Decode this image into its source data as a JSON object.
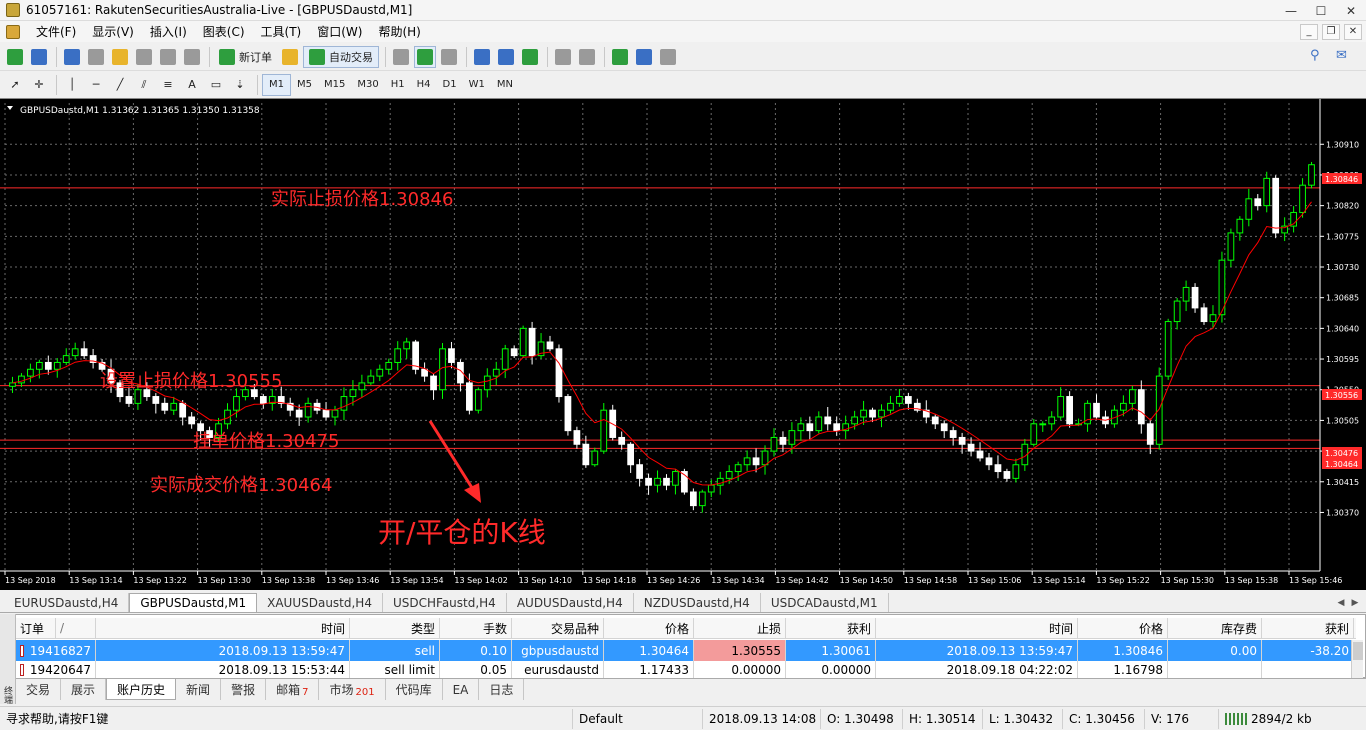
{
  "window": {
    "title": "61057161: RakutenSecuritiesAustralia-Live - [GBPUSDaustd,M1]",
    "min_label": "—",
    "max_label": "☐",
    "close_label": "✕"
  },
  "menu": {
    "items": [
      "文件(F)",
      "显示(V)",
      "插入(I)",
      "图表(C)",
      "工具(T)",
      "窗口(W)",
      "帮助(H)"
    ]
  },
  "toolbar": {
    "new_order": "新订单",
    "auto_trading": "自动交易",
    "timeframes": [
      "M1",
      "M5",
      "M15",
      "M30",
      "H1",
      "H4",
      "D1",
      "W1",
      "MN"
    ]
  },
  "chart": {
    "header": "GBPUSDaustd,M1  1.31362 1.31365 1.31350 1.31358",
    "annotations": {
      "actual_sl": "实际止损价格1.30846",
      "set_sl": "设置止损价格1.30555",
      "pending": "挂单价格1.30475",
      "actual_fill": "实际成交价格1.30464",
      "candle_note": "开/平仓的K线"
    },
    "price_tags": {
      "sl_actual": "1.30846",
      "sl_set": "1.30556",
      "pending": "1.30476",
      "fill": "1.30464"
    }
  },
  "chart_data": {
    "type": "candlestick",
    "symbol": "GBPUSDaustd",
    "timeframe": "M1",
    "ylim": [
      1.3029,
      1.3095
    ],
    "price_ticks": [
      "1.30910",
      "1.30865",
      "1.30820",
      "1.30775",
      "1.30730",
      "1.30685",
      "1.30640",
      "1.30595",
      "1.30550",
      "1.30505",
      "1.30460",
      "1.30415",
      "1.30370"
    ],
    "price_tick_values": [
      1.3091,
      1.30865,
      1.3082,
      1.30775,
      1.3073,
      1.30685,
      1.3064,
      1.30595,
      1.3055,
      1.30505,
      1.3046,
      1.30415,
      1.3037
    ],
    "time_ticks": [
      "13 Sep 2018",
      "13 Sep 13:14",
      "13 Sep 13:22",
      "13 Sep 13:30",
      "13 Sep 13:38",
      "13 Sep 13:46",
      "13 Sep 13:54",
      "13 Sep 14:02",
      "13 Sep 14:10",
      "13 Sep 14:18",
      "13 Sep 14:26",
      "13 Sep 14:34",
      "13 Sep 14:42",
      "13 Sep 14:50",
      "13 Sep 14:58",
      "13 Sep 15:06",
      "13 Sep 15:14",
      "13 Sep 15:22",
      "13 Sep 15:30",
      "13 Sep 15:38",
      "13 Sep 15:46"
    ],
    "hlines": [
      1.30846,
      1.30556,
      1.30476,
      1.30464
    ],
    "closes": [
      1.3056,
      1.3057,
      1.3058,
      1.3059,
      1.3058,
      1.3059,
      1.306,
      1.3061,
      1.306,
      1.3059,
      1.3058,
      1.3056,
      1.3054,
      1.3053,
      1.3055,
      1.3054,
      1.3053,
      1.3052,
      1.3053,
      1.3051,
      1.305,
      1.3049,
      1.3048,
      1.305,
      1.3052,
      1.3054,
      1.3055,
      1.3054,
      1.3053,
      1.3054,
      1.3053,
      1.3052,
      1.3051,
      1.3053,
      1.3052,
      1.3051,
      1.3052,
      1.3054,
      1.3055,
      1.3056,
      1.3057,
      1.3058,
      1.3059,
      1.3061,
      1.3062,
      1.3058,
      1.3057,
      1.3055,
      1.3061,
      1.3059,
      1.3056,
      1.3052,
      1.3055,
      1.3057,
      1.3058,
      1.3061,
      1.306,
      1.3064,
      1.306,
      1.3062,
      1.3061,
      1.3054,
      1.3049,
      1.3047,
      1.3044,
      1.3046,
      1.3052,
      1.3048,
      1.3047,
      1.3044,
      1.3042,
      1.3041,
      1.3042,
      1.3041,
      1.3043,
      1.304,
      1.3038,
      1.304,
      1.3041,
      1.3042,
      1.3043,
      1.3044,
      1.3045,
      1.3044,
      1.3046,
      1.3048,
      1.3047,
      1.3049,
      1.305,
      1.3049,
      1.3051,
      1.305,
      1.3049,
      1.305,
      1.3051,
      1.3052,
      1.3051,
      1.3052,
      1.3053,
      1.3054,
      1.3053,
      1.3052,
      1.3051,
      1.305,
      1.3049,
      1.3048,
      1.3047,
      1.3046,
      1.3045,
      1.3044,
      1.3043,
      1.3042,
      1.3044,
      1.3047,
      1.305,
      1.305,
      1.3051,
      1.3054,
      1.305,
      1.305,
      1.3053,
      1.3051,
      1.305,
      1.3052,
      1.3053,
      1.3055,
      1.305,
      1.3047,
      1.3057,
      1.3065,
      1.3068,
      1.307,
      1.3067,
      1.3065,
      1.3066,
      1.3074,
      1.3078,
      1.308,
      1.3083,
      1.3082,
      1.3086,
      1.3078,
      1.3079,
      1.3081,
      1.3085,
      1.3088
    ]
  },
  "symbol_tabs": [
    "EURUSDaustd,H4",
    "GBPUSDaustd,M1",
    "XAUUSDaustd,H4",
    "USDCHFaustd,H4",
    "AUDUSDaustd,H4",
    "NZDUSDaustd,H4",
    "USDCADaustd,M1"
  ],
  "terminal": {
    "headers": [
      "订单",
      "/",
      "时间",
      "类型",
      "手数",
      "交易品种",
      "价格",
      "止损",
      "获利",
      "时间",
      "价格",
      "库存费",
      "获利"
    ],
    "rows": [
      [
        "19416827",
        "2018.09.13 13:59:47",
        "sell",
        "0.10",
        "gbpusdaustd",
        "1.30464",
        "1.30555",
        "1.30061",
        "2018.09.13 13:59:47",
        "1.30846",
        "0.00",
        "-38.20"
      ],
      [
        "19420647",
        "2018.09.13 15:53:44",
        "sell limit",
        "0.05",
        "eurusdaustd",
        "1.17433",
        "0.00000",
        "0.00000",
        "2018.09.18 04:22:02",
        "1.16798",
        "",
        ""
      ]
    ],
    "side_label": "终端",
    "tabs": [
      {
        "label": "交易",
        "count": ""
      },
      {
        "label": "展示",
        "count": ""
      },
      {
        "label": "账户历史",
        "count": ""
      },
      {
        "label": "新闻",
        "count": ""
      },
      {
        "label": "警报",
        "count": ""
      },
      {
        "label": "邮箱",
        "count": "7"
      },
      {
        "label": "市场",
        "count": "201"
      },
      {
        "label": "代码库",
        "count": ""
      },
      {
        "label": "EA",
        "count": ""
      },
      {
        "label": "日志",
        "count": ""
      }
    ]
  },
  "status": {
    "help": "寻求帮助,请按F1键",
    "profile": "Default",
    "datetime": "2018.09.13 14:08",
    "open": "O: 1.30498",
    "high": "H: 1.30514",
    "low": "L: 1.30432",
    "close": "C: 1.30456",
    "volume": "V: 176",
    "traffic": "2894/2 kb"
  },
  "colors": {
    "bull": "#00ff00",
    "bear": "#ffffff",
    "ma": "#ff0000",
    "annotation": "#ff2a2a",
    "selected_row": "#3399ff",
    "sl_cell": "#f39b9b"
  }
}
